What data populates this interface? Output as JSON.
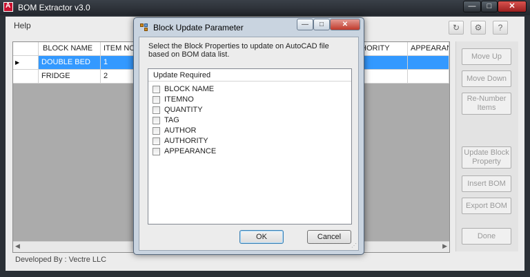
{
  "window": {
    "title": "BOM Extractor v3.0",
    "min_label": "—",
    "max_label": "□",
    "close_label": "✕"
  },
  "menu": {
    "help": "Help"
  },
  "toolbar_icons": [
    "refresh-icon",
    "gear-icon",
    "help-icon"
  ],
  "toolbar_glyphs": [
    "↻",
    "⚙",
    "?"
  ],
  "grid": {
    "columns": [
      "BLOCK NAME",
      "ITEM NO",
      "HORITY",
      "APPEARAN"
    ],
    "rows": [
      {
        "block_name": "DOUBLE BED",
        "item_no": "1",
        "selected": true
      },
      {
        "block_name": "FRIDGE",
        "item_no": "2",
        "selected": false
      }
    ],
    "row_indicator": "▶"
  },
  "panel": {
    "move_up": "Move Up",
    "move_down": "Move Down",
    "renumber": "Re-Number Items",
    "update_block": "Update Block Property",
    "insert_bom": "Insert BOM",
    "export_bom": "Export BOM",
    "done": "Done"
  },
  "footer": {
    "developed_by": "Developed By :   Vectre LLC"
  },
  "dialog": {
    "title": "Block Update Parameter",
    "description": "Select the Block Properties to update on AutoCAD file based on BOM data list.",
    "list_header": "Update Required",
    "items": [
      "BLOCK NAME",
      "ITEMNO",
      "QUANTITY",
      "TAG",
      "AUTHOR",
      "AUTHORITY",
      "APPEARANCE"
    ],
    "ok": "OK",
    "cancel": "Cancel"
  },
  "colors": {
    "selection": "#3399ff",
    "window_frame": "#2b3036",
    "dialog_frame": "#c9d4e0"
  }
}
